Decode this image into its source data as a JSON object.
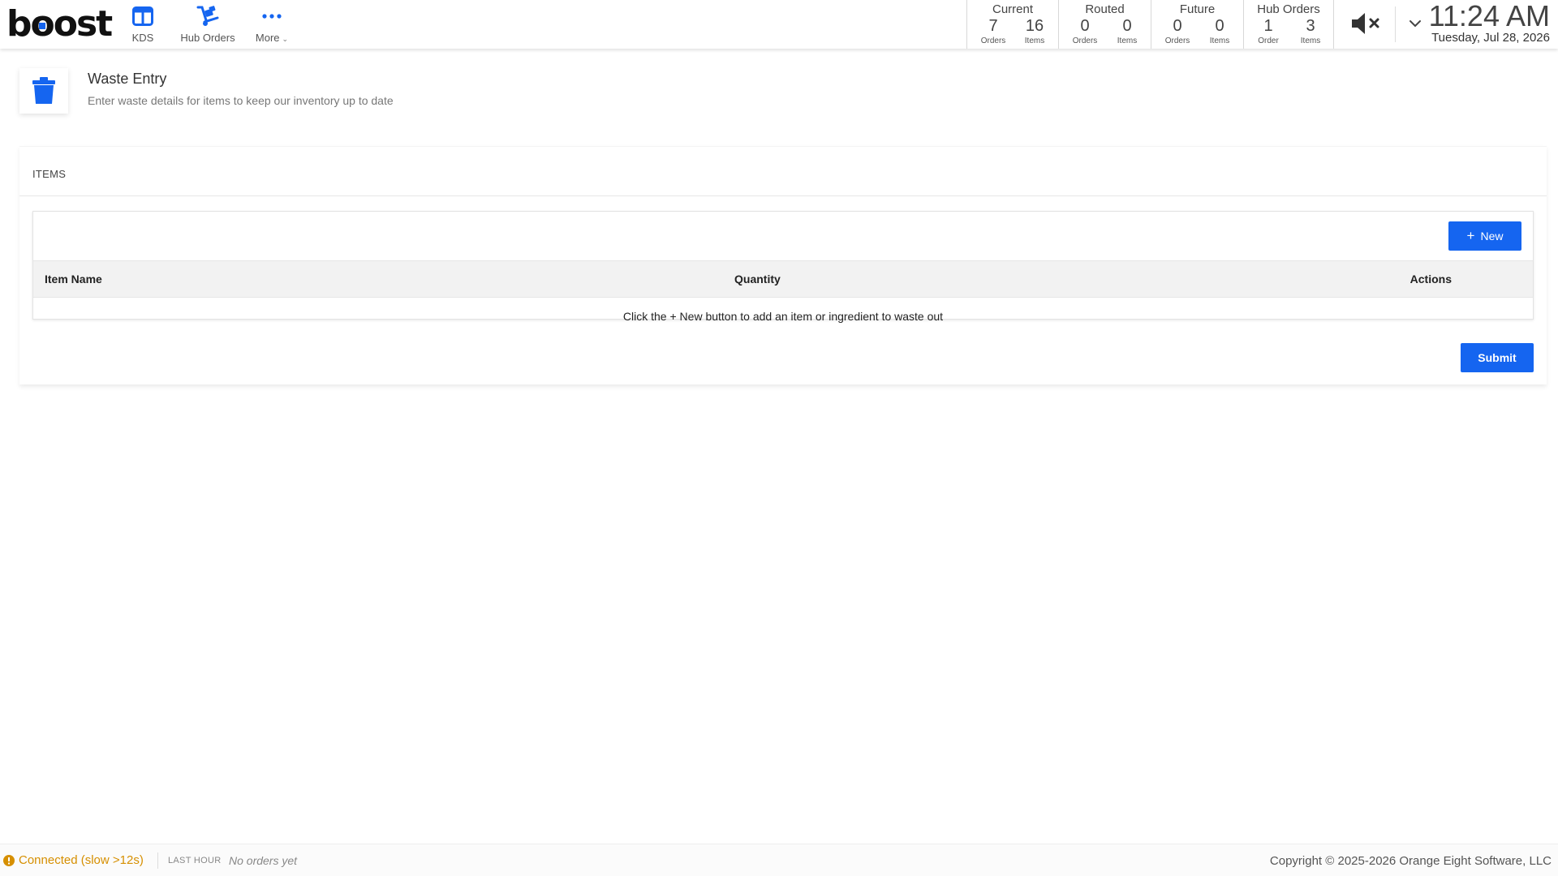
{
  "app": {
    "logo_text_b": "b",
    "logo_text_o": "o",
    "logo_text_rest": "ost",
    "brand_color": "#1565f0"
  },
  "nav": {
    "kds_label": "KDS",
    "hub_label": "Hub Orders",
    "more_label": "More",
    "more_caret": "⌄"
  },
  "stats": {
    "current": {
      "title": "Current",
      "orders": "7",
      "orders_label": "Orders",
      "items": "16",
      "items_label": "Items"
    },
    "routed": {
      "title": "Routed",
      "orders": "0",
      "orders_label": "Orders",
      "items": "0",
      "items_label": "Items"
    },
    "future": {
      "title": "Future",
      "orders": "0",
      "orders_label": "Orders",
      "items": "0",
      "items_label": "Items"
    },
    "hub": {
      "title": "Hub Orders",
      "orders": "1",
      "orders_label": "Order",
      "items": "3",
      "items_label": "Items"
    }
  },
  "clock": {
    "time": "11:24 AM",
    "date": "Tuesday, Jul 28, 2026"
  },
  "page": {
    "title": "Waste Entry",
    "subtitle": "Enter waste details for items to keep our inventory up to date"
  },
  "card": {
    "header": "ITEMS",
    "new_label": "New",
    "columns": [
      "Item Name",
      "Quantity",
      "Actions"
    ],
    "empty_message": "Click the + New button to add an item or ingredient to waste out",
    "submit_label": "Submit"
  },
  "footer": {
    "status": "Connected (slow >12s)",
    "status_color": "#d68f00",
    "last_hour_label": "LAST HOUR",
    "last_hour_value": "No orders yet",
    "copyright": "Copyright © 2025-2026 Orange Eight Software, LLC"
  }
}
